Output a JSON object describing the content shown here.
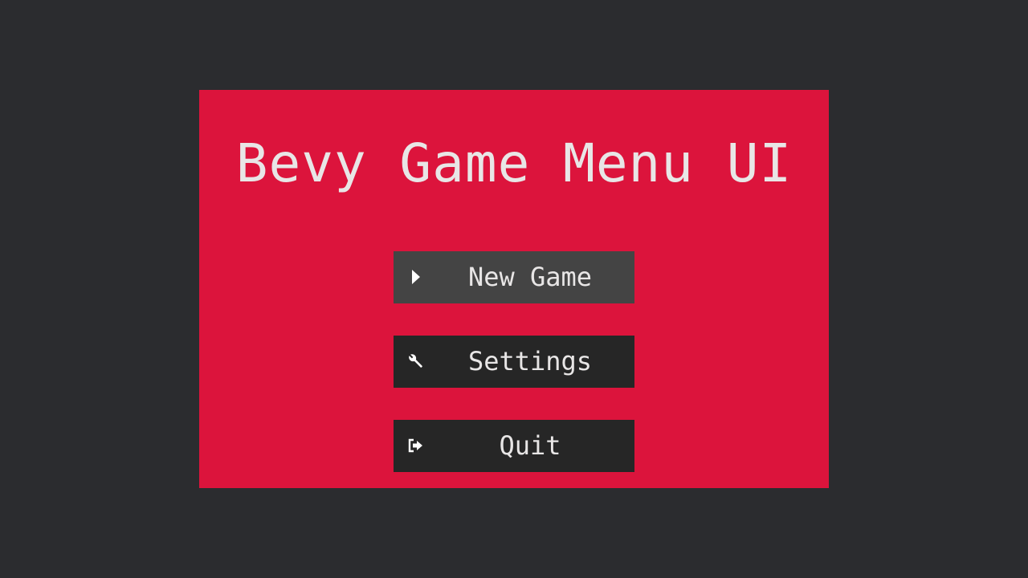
{
  "title": "Bevy Game Menu UI",
  "buttons": {
    "new_game": {
      "label": "New Game",
      "icon": "play-icon"
    },
    "settings": {
      "label": "Settings",
      "icon": "wrench-icon"
    },
    "quit": {
      "label": "Quit",
      "icon": "exit-icon"
    }
  },
  "colors": {
    "background": "#2b2c2f",
    "panel": "#dc143c",
    "button": "#262626",
    "button_hovered": "#444444",
    "text": "#e8e6e6"
  }
}
